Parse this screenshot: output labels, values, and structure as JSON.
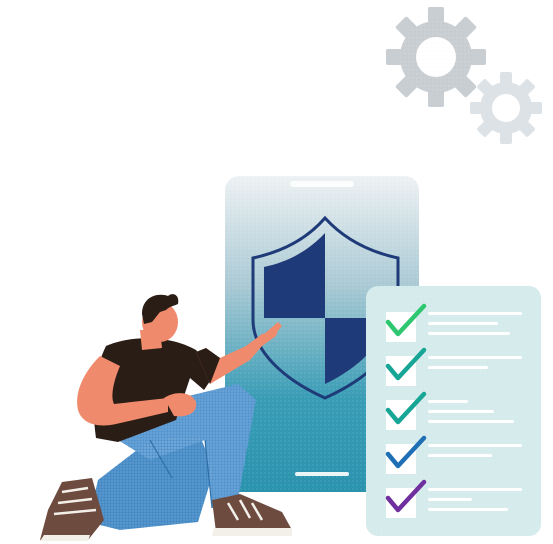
{
  "illustration": {
    "subject": "security-verification",
    "icons": [
      "gear-icon",
      "gear-icon",
      "shield-icon",
      "check-icon",
      "check-icon",
      "check-icon",
      "check-icon",
      "check-icon"
    ]
  },
  "checklist": {
    "item_count": 5,
    "check_colors": [
      "#2ec76f",
      "#17a596",
      "#17a596",
      "#1f6fb5",
      "#6f2f9e"
    ]
  },
  "colors": {
    "phone_top": "#e8eef2",
    "phone_bottom": "#2a95b0",
    "shield_dark": "#1f3a78",
    "panel_bg": "#d6ebeb",
    "panel_lines": "#ffffff",
    "gear": "#c9ced3",
    "shirt": "#2a1d16",
    "skin": "#f08a6c",
    "jeans": "#4a8ec8",
    "shoe": "#6e4b3f"
  }
}
